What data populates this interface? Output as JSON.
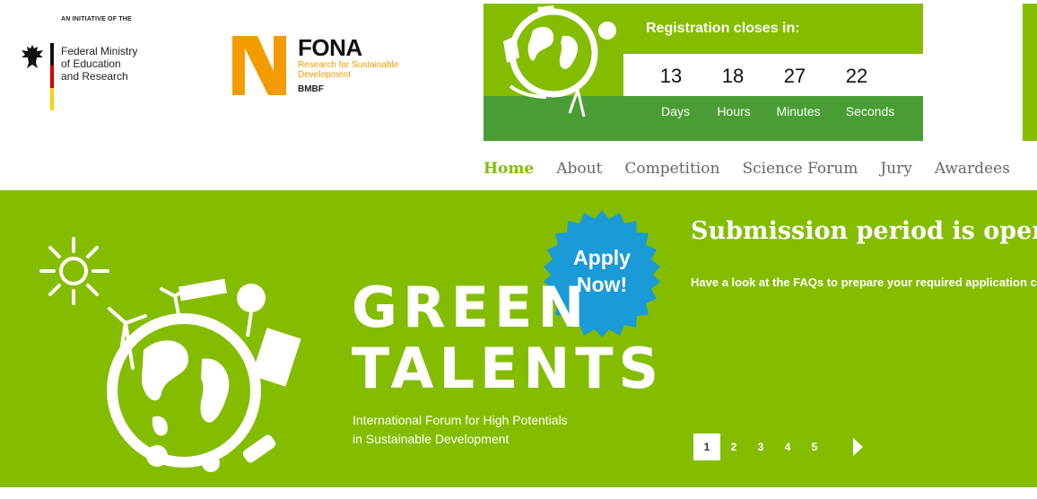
{
  "header": {
    "initiative": "AN INITIATIVE OF THE",
    "ministry_lines": [
      "Federal Ministry",
      "of Education",
      "and Research"
    ],
    "fona_title": "FONA",
    "fona_sub_lines": [
      "Research for Sustainable",
      "Development"
    ],
    "fona_org": "BMBF"
  },
  "countdown": {
    "label": "Registration closes in:",
    "items": [
      {
        "value": "13",
        "unit": "Days"
      },
      {
        "value": "18",
        "unit": "Hours"
      },
      {
        "value": "27",
        "unit": "Minutes"
      },
      {
        "value": "22",
        "unit": "Seconds"
      }
    ]
  },
  "nav": {
    "items": [
      "Home",
      "About",
      "Competition",
      "Science Forum",
      "Jury",
      "Awardees"
    ],
    "active": "Home"
  },
  "hero": {
    "badge_lines": [
      "Apply",
      "Now!"
    ],
    "logo_lines": [
      "GREEN",
      "TALENTS"
    ],
    "tagline_lines": [
      "International Forum for High Potentials",
      "in Sustainable Development"
    ],
    "headline": "Submission period is open",
    "description": "Have a look at the FAQs to prepare your required application c"
  },
  "pager": {
    "pages": [
      "1",
      "2",
      "3",
      "4",
      "5"
    ],
    "active": "1"
  },
  "colors": {
    "brand_green": "#84bd00",
    "dark_green": "#4a9d34",
    "badge_blue": "#1a9ad6",
    "fona_orange": "#f39c00"
  }
}
